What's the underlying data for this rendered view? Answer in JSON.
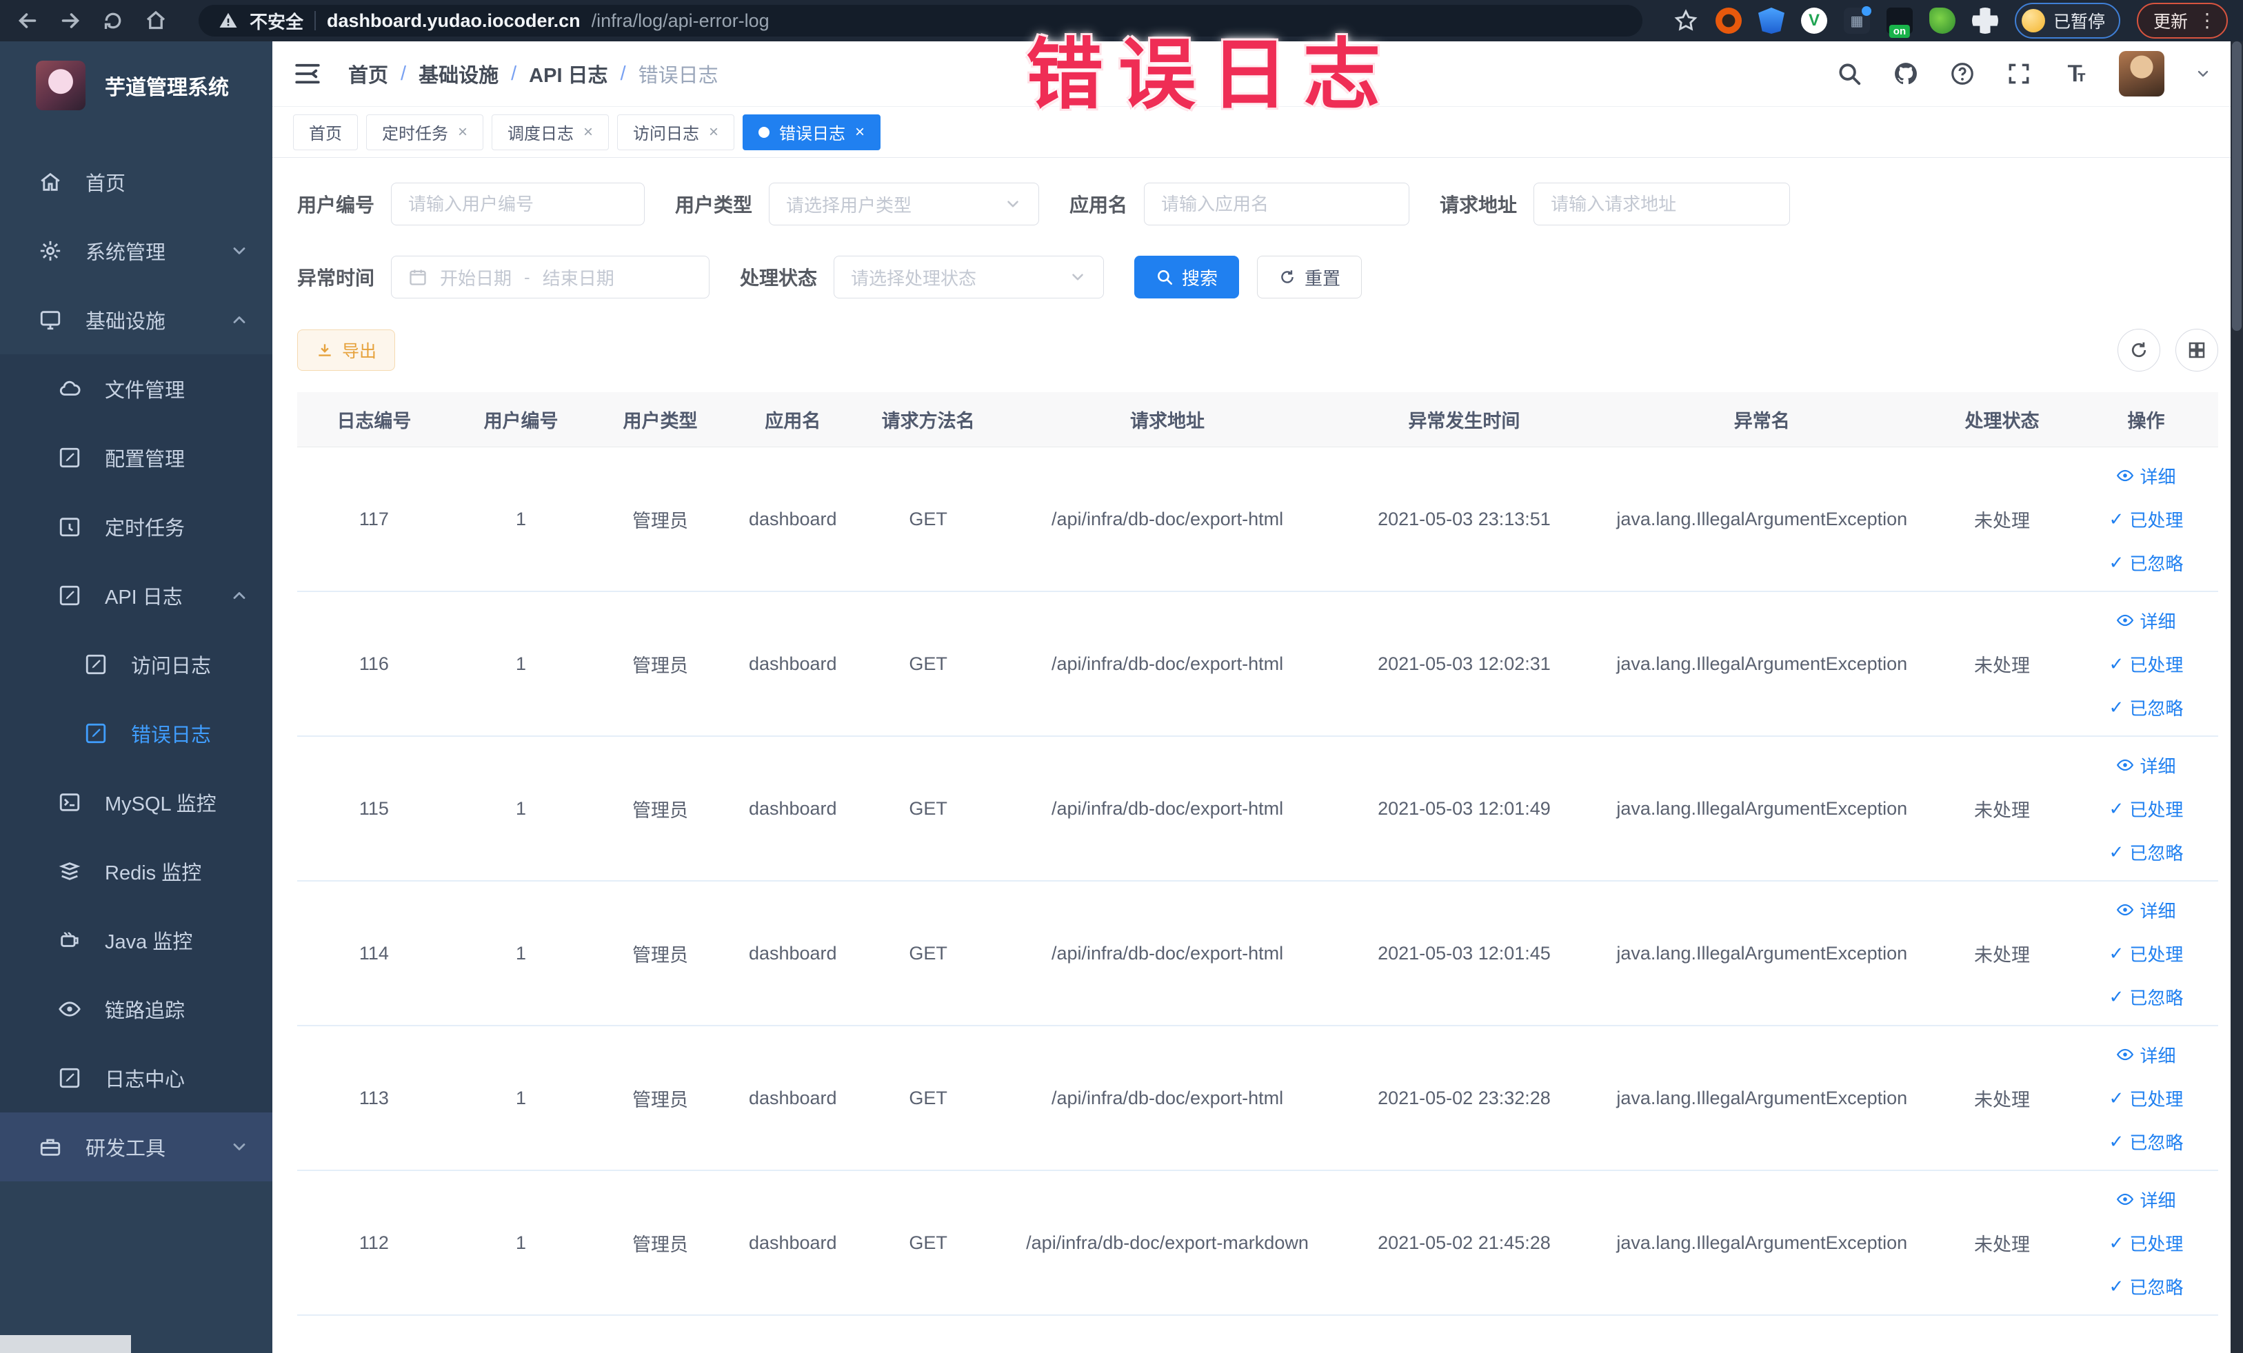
{
  "annotation": {
    "text": "错误日志"
  },
  "colors": {
    "accent_blue": "#2080f0",
    "active_link": "#409eff",
    "annotation_pink": "#ef2d55",
    "export_orange": "#e6a23c",
    "sidebar_bg": "#2d4157"
  },
  "icons": {
    "close": "×",
    "check": "✓",
    "dots": "⋮"
  },
  "browser": {
    "security_label": "不安全",
    "url_domain": "dashboard.yudao.iocoder.cn",
    "url_path": "/infra/log/api-error-log",
    "ext_on_badge": "on",
    "paused_badge": "已暂停",
    "update_button": "更新"
  },
  "sidebar": {
    "title": "芋道管理系统",
    "menu": [
      {
        "label": "首页"
      },
      {
        "label": "系统管理"
      },
      {
        "label": "基础设施"
      },
      {
        "label": "文件管理"
      },
      {
        "label": "配置管理"
      },
      {
        "label": "定时任务"
      },
      {
        "label": "API 日志"
      },
      {
        "label": "访问日志"
      },
      {
        "label": "错误日志"
      },
      {
        "label": "MySQL 监控"
      },
      {
        "label": "Redis 监控"
      },
      {
        "label": "Java 监控"
      },
      {
        "label": "链路追踪"
      },
      {
        "label": "日志中心"
      },
      {
        "label": "研发工具"
      }
    ]
  },
  "breadcrumb": {
    "separator": "/",
    "items": [
      "首页",
      "基础设施",
      "API 日志",
      "错误日志"
    ]
  },
  "tabs": [
    {
      "label": "首页"
    },
    {
      "label": "定时任务"
    },
    {
      "label": "调度日志"
    },
    {
      "label": "访问日志"
    },
    {
      "label": "错误日志"
    }
  ],
  "filters": {
    "user_id_label": "用户编号",
    "user_id_placeholder": "请输入用户编号",
    "user_type_label": "用户类型",
    "user_type_placeholder": "请选择用户类型",
    "app_name_label": "应用名",
    "app_name_placeholder": "请输入应用名",
    "request_url_label": "请求地址",
    "request_url_placeholder": "请输入请求地址",
    "time_label": "异常时间",
    "time_start_placeholder": "开始日期",
    "time_separator": "-",
    "time_end_placeholder": "结束日期",
    "status_label": "处理状态",
    "status_placeholder": "请选择处理状态",
    "search_button": "搜索",
    "reset_button": "重置"
  },
  "toolbar": {
    "export_button": "导出"
  },
  "table": {
    "headers": [
      "日志编号",
      "用户编号",
      "用户类型",
      "应用名",
      "请求方法名",
      "请求地址",
      "异常发生时间",
      "异常名",
      "处理状态",
      "操作"
    ],
    "actions": {
      "detail": "详细",
      "processed": "已处理",
      "ignored": "已忽略"
    },
    "rows": [
      {
        "id": "117",
        "user_id": "1",
        "user_type": "管理员",
        "app": "dashboard",
        "method": "GET",
        "url": "/api/infra/db-doc/export-html",
        "time": "2021-05-03 23:13:51",
        "exception": "java.lang.IllegalArgumentException",
        "status": "未处理"
      },
      {
        "id": "116",
        "user_id": "1",
        "user_type": "管理员",
        "app": "dashboard",
        "method": "GET",
        "url": "/api/infra/db-doc/export-html",
        "time": "2021-05-03 12:02:31",
        "exception": "java.lang.IllegalArgumentException",
        "status": "未处理"
      },
      {
        "id": "115",
        "user_id": "1",
        "user_type": "管理员",
        "app": "dashboard",
        "method": "GET",
        "url": "/api/infra/db-doc/export-html",
        "time": "2021-05-03 12:01:49",
        "exception": "java.lang.IllegalArgumentException",
        "status": "未处理"
      },
      {
        "id": "114",
        "user_id": "1",
        "user_type": "管理员",
        "app": "dashboard",
        "method": "GET",
        "url": "/api/infra/db-doc/export-html",
        "time": "2021-05-03 12:01:45",
        "exception": "java.lang.IllegalArgumentException",
        "status": "未处理"
      },
      {
        "id": "113",
        "user_id": "1",
        "user_type": "管理员",
        "app": "dashboard",
        "method": "GET",
        "url": "/api/infra/db-doc/export-html",
        "time": "2021-05-02 23:32:28",
        "exception": "java.lang.IllegalArgumentException",
        "status": "未处理"
      },
      {
        "id": "112",
        "user_id": "1",
        "user_type": "管理员",
        "app": "dashboard",
        "method": "GET",
        "url": "/api/infra/db-doc/export-markdown",
        "time": "2021-05-02 21:45:28",
        "exception": "java.lang.IllegalArgumentException",
        "status": "未处理"
      }
    ]
  }
}
